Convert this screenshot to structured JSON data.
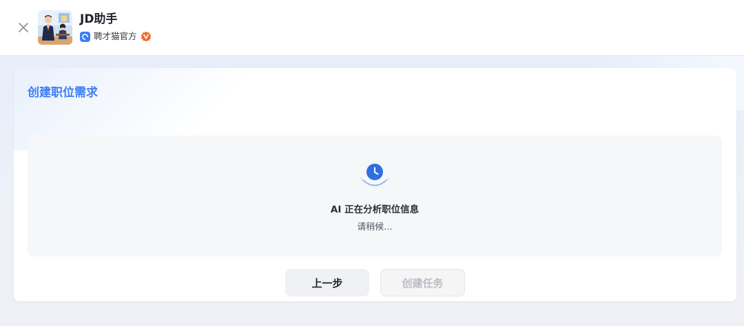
{
  "header": {
    "app_title": "JD助手",
    "publisher_name": "聘才猫官方",
    "close_icon": "close-icon",
    "verified_icon": "verified-badge-icon"
  },
  "card": {
    "title": "创建职位需求",
    "status": {
      "icon": "clock-icon",
      "message": "AI 正在分析职位信息",
      "sub_message": "请稍候..."
    },
    "buttons": {
      "prev_label": "上一步",
      "create_label": "创建任务"
    }
  },
  "colors": {
    "accent": "#3d7ef4",
    "verified": "#f26a2b",
    "disabled_text": "#b9bcc2"
  }
}
